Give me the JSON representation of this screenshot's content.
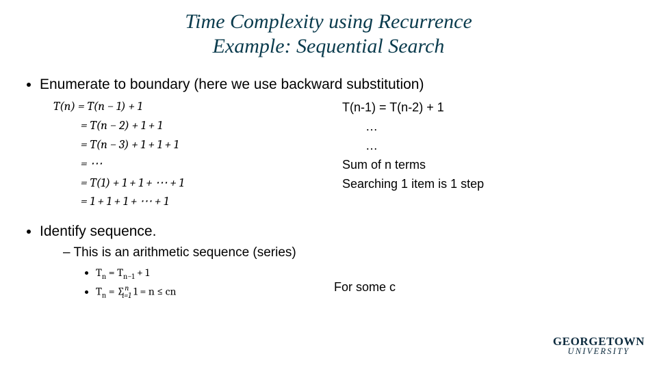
{
  "title": {
    "line1": "Time Complexity using Recurrence",
    "line2": "Example: Sequential Search"
  },
  "bullets": {
    "enumerate": "Enumerate to boundary (here we use backward substitution)",
    "identify": "Identify sequence.",
    "arithmetic": "This is an arithmetic sequence (series)"
  },
  "eq": {
    "l1": "T(n) = T(n − 1) + 1",
    "l2": "= T(n − 2) + 1 + 1",
    "l3": "= T(n − 3) + 1 + 1 + 1",
    "l4": "= ⋯",
    "l5": "= T(1) + 1 + 1 + ⋯ + 1",
    "l6": "= 1 + 1 + 1 + ⋯ + 1"
  },
  "right": {
    "r1": "T(n-1) = T(n-2) + 1",
    "r2": "…",
    "r3": "…",
    "r4": "Sum of n terms",
    "r5": "Searching 1 item is 1 step"
  },
  "seq": {
    "t1_pre": "T",
    "t1_sub": "n",
    "t1_mid": " = T",
    "t1_sub2": "n−1",
    "t1_post": " + 1",
    "t2_pre": "T",
    "t2_sub": "n",
    "t2_eq": " = ",
    "t2_sigma": "∑",
    "t2_low": "i=1",
    "t2_up": "n",
    "t2_body": " 1 = n ≤ cn"
  },
  "for_some": "For some c",
  "logo": {
    "top": "GEORGETOWN",
    "bot": "UNIVERSITY"
  }
}
